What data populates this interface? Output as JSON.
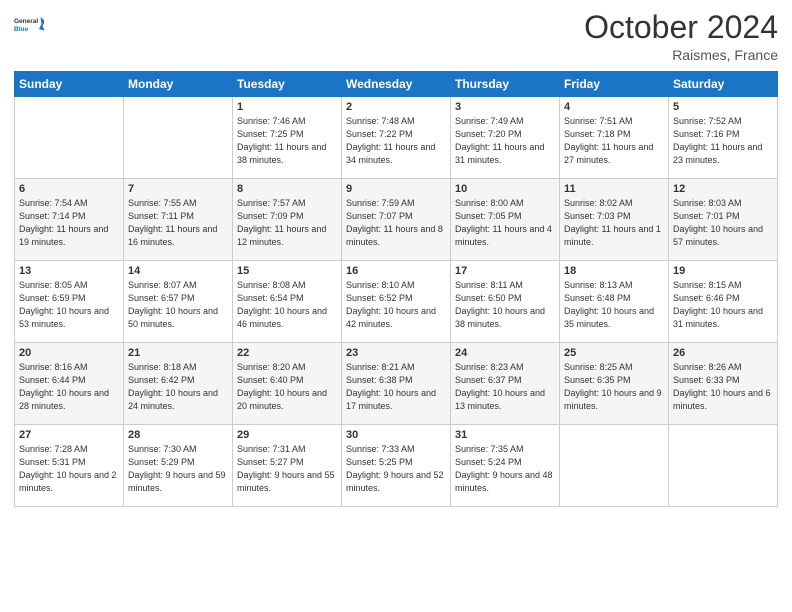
{
  "header": {
    "logo_line1": "General",
    "logo_line2": "Blue",
    "month": "October 2024",
    "location": "Raismes, France"
  },
  "weekdays": [
    "Sunday",
    "Monday",
    "Tuesday",
    "Wednesday",
    "Thursday",
    "Friday",
    "Saturday"
  ],
  "weeks": [
    [
      {
        "day": "",
        "sunrise": "",
        "sunset": "",
        "daylight": ""
      },
      {
        "day": "",
        "sunrise": "",
        "sunset": "",
        "daylight": ""
      },
      {
        "day": "1",
        "sunrise": "Sunrise: 7:46 AM",
        "sunset": "Sunset: 7:25 PM",
        "daylight": "Daylight: 11 hours and 38 minutes."
      },
      {
        "day": "2",
        "sunrise": "Sunrise: 7:48 AM",
        "sunset": "Sunset: 7:22 PM",
        "daylight": "Daylight: 11 hours and 34 minutes."
      },
      {
        "day": "3",
        "sunrise": "Sunrise: 7:49 AM",
        "sunset": "Sunset: 7:20 PM",
        "daylight": "Daylight: 11 hours and 31 minutes."
      },
      {
        "day": "4",
        "sunrise": "Sunrise: 7:51 AM",
        "sunset": "Sunset: 7:18 PM",
        "daylight": "Daylight: 11 hours and 27 minutes."
      },
      {
        "day": "5",
        "sunrise": "Sunrise: 7:52 AM",
        "sunset": "Sunset: 7:16 PM",
        "daylight": "Daylight: 11 hours and 23 minutes."
      }
    ],
    [
      {
        "day": "6",
        "sunrise": "Sunrise: 7:54 AM",
        "sunset": "Sunset: 7:14 PM",
        "daylight": "Daylight: 11 hours and 19 minutes."
      },
      {
        "day": "7",
        "sunrise": "Sunrise: 7:55 AM",
        "sunset": "Sunset: 7:11 PM",
        "daylight": "Daylight: 11 hours and 16 minutes."
      },
      {
        "day": "8",
        "sunrise": "Sunrise: 7:57 AM",
        "sunset": "Sunset: 7:09 PM",
        "daylight": "Daylight: 11 hours and 12 minutes."
      },
      {
        "day": "9",
        "sunrise": "Sunrise: 7:59 AM",
        "sunset": "Sunset: 7:07 PM",
        "daylight": "Daylight: 11 hours and 8 minutes."
      },
      {
        "day": "10",
        "sunrise": "Sunrise: 8:00 AM",
        "sunset": "Sunset: 7:05 PM",
        "daylight": "Daylight: 11 hours and 4 minutes."
      },
      {
        "day": "11",
        "sunrise": "Sunrise: 8:02 AM",
        "sunset": "Sunset: 7:03 PM",
        "daylight": "Daylight: 11 hours and 1 minute."
      },
      {
        "day": "12",
        "sunrise": "Sunrise: 8:03 AM",
        "sunset": "Sunset: 7:01 PM",
        "daylight": "Daylight: 10 hours and 57 minutes."
      }
    ],
    [
      {
        "day": "13",
        "sunrise": "Sunrise: 8:05 AM",
        "sunset": "Sunset: 6:59 PM",
        "daylight": "Daylight: 10 hours and 53 minutes."
      },
      {
        "day": "14",
        "sunrise": "Sunrise: 8:07 AM",
        "sunset": "Sunset: 6:57 PM",
        "daylight": "Daylight: 10 hours and 50 minutes."
      },
      {
        "day": "15",
        "sunrise": "Sunrise: 8:08 AM",
        "sunset": "Sunset: 6:54 PM",
        "daylight": "Daylight: 10 hours and 46 minutes."
      },
      {
        "day": "16",
        "sunrise": "Sunrise: 8:10 AM",
        "sunset": "Sunset: 6:52 PM",
        "daylight": "Daylight: 10 hours and 42 minutes."
      },
      {
        "day": "17",
        "sunrise": "Sunrise: 8:11 AM",
        "sunset": "Sunset: 6:50 PM",
        "daylight": "Daylight: 10 hours and 38 minutes."
      },
      {
        "day": "18",
        "sunrise": "Sunrise: 8:13 AM",
        "sunset": "Sunset: 6:48 PM",
        "daylight": "Daylight: 10 hours and 35 minutes."
      },
      {
        "day": "19",
        "sunrise": "Sunrise: 8:15 AM",
        "sunset": "Sunset: 6:46 PM",
        "daylight": "Daylight: 10 hours and 31 minutes."
      }
    ],
    [
      {
        "day": "20",
        "sunrise": "Sunrise: 8:16 AM",
        "sunset": "Sunset: 6:44 PM",
        "daylight": "Daylight: 10 hours and 28 minutes."
      },
      {
        "day": "21",
        "sunrise": "Sunrise: 8:18 AM",
        "sunset": "Sunset: 6:42 PM",
        "daylight": "Daylight: 10 hours and 24 minutes."
      },
      {
        "day": "22",
        "sunrise": "Sunrise: 8:20 AM",
        "sunset": "Sunset: 6:40 PM",
        "daylight": "Daylight: 10 hours and 20 minutes."
      },
      {
        "day": "23",
        "sunrise": "Sunrise: 8:21 AM",
        "sunset": "Sunset: 6:38 PM",
        "daylight": "Daylight: 10 hours and 17 minutes."
      },
      {
        "day": "24",
        "sunrise": "Sunrise: 8:23 AM",
        "sunset": "Sunset: 6:37 PM",
        "daylight": "Daylight: 10 hours and 13 minutes."
      },
      {
        "day": "25",
        "sunrise": "Sunrise: 8:25 AM",
        "sunset": "Sunset: 6:35 PM",
        "daylight": "Daylight: 10 hours and 9 minutes."
      },
      {
        "day": "26",
        "sunrise": "Sunrise: 8:26 AM",
        "sunset": "Sunset: 6:33 PM",
        "daylight": "Daylight: 10 hours and 6 minutes."
      }
    ],
    [
      {
        "day": "27",
        "sunrise": "Sunrise: 7:28 AM",
        "sunset": "Sunset: 5:31 PM",
        "daylight": "Daylight: 10 hours and 2 minutes."
      },
      {
        "day": "28",
        "sunrise": "Sunrise: 7:30 AM",
        "sunset": "Sunset: 5:29 PM",
        "daylight": "Daylight: 9 hours and 59 minutes."
      },
      {
        "day": "29",
        "sunrise": "Sunrise: 7:31 AM",
        "sunset": "Sunset: 5:27 PM",
        "daylight": "Daylight: 9 hours and 55 minutes."
      },
      {
        "day": "30",
        "sunrise": "Sunrise: 7:33 AM",
        "sunset": "Sunset: 5:25 PM",
        "daylight": "Daylight: 9 hours and 52 minutes."
      },
      {
        "day": "31",
        "sunrise": "Sunrise: 7:35 AM",
        "sunset": "Sunset: 5:24 PM",
        "daylight": "Daylight: 9 hours and 48 minutes."
      },
      {
        "day": "",
        "sunrise": "",
        "sunset": "",
        "daylight": ""
      },
      {
        "day": "",
        "sunrise": "",
        "sunset": "",
        "daylight": ""
      }
    ]
  ]
}
